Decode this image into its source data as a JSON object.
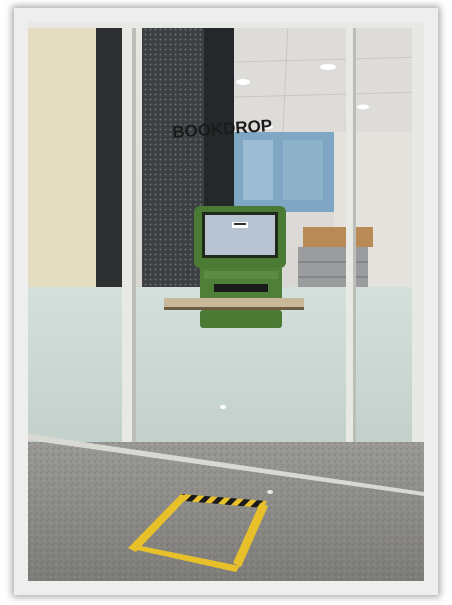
{
  "photo": {
    "sign_text": "BOOKDROP"
  },
  "colors": {
    "wall_top": "#d6d3cf",
    "glass_frosted": "#cfdcd8",
    "floor": "#8b8a86",
    "frame": "#e6e6e2",
    "kiosk_green": "#4a7a34",
    "screen": "#b8c4d2",
    "tape_yellow": "#e8c12a",
    "tape_black": "#1a1a1a"
  }
}
